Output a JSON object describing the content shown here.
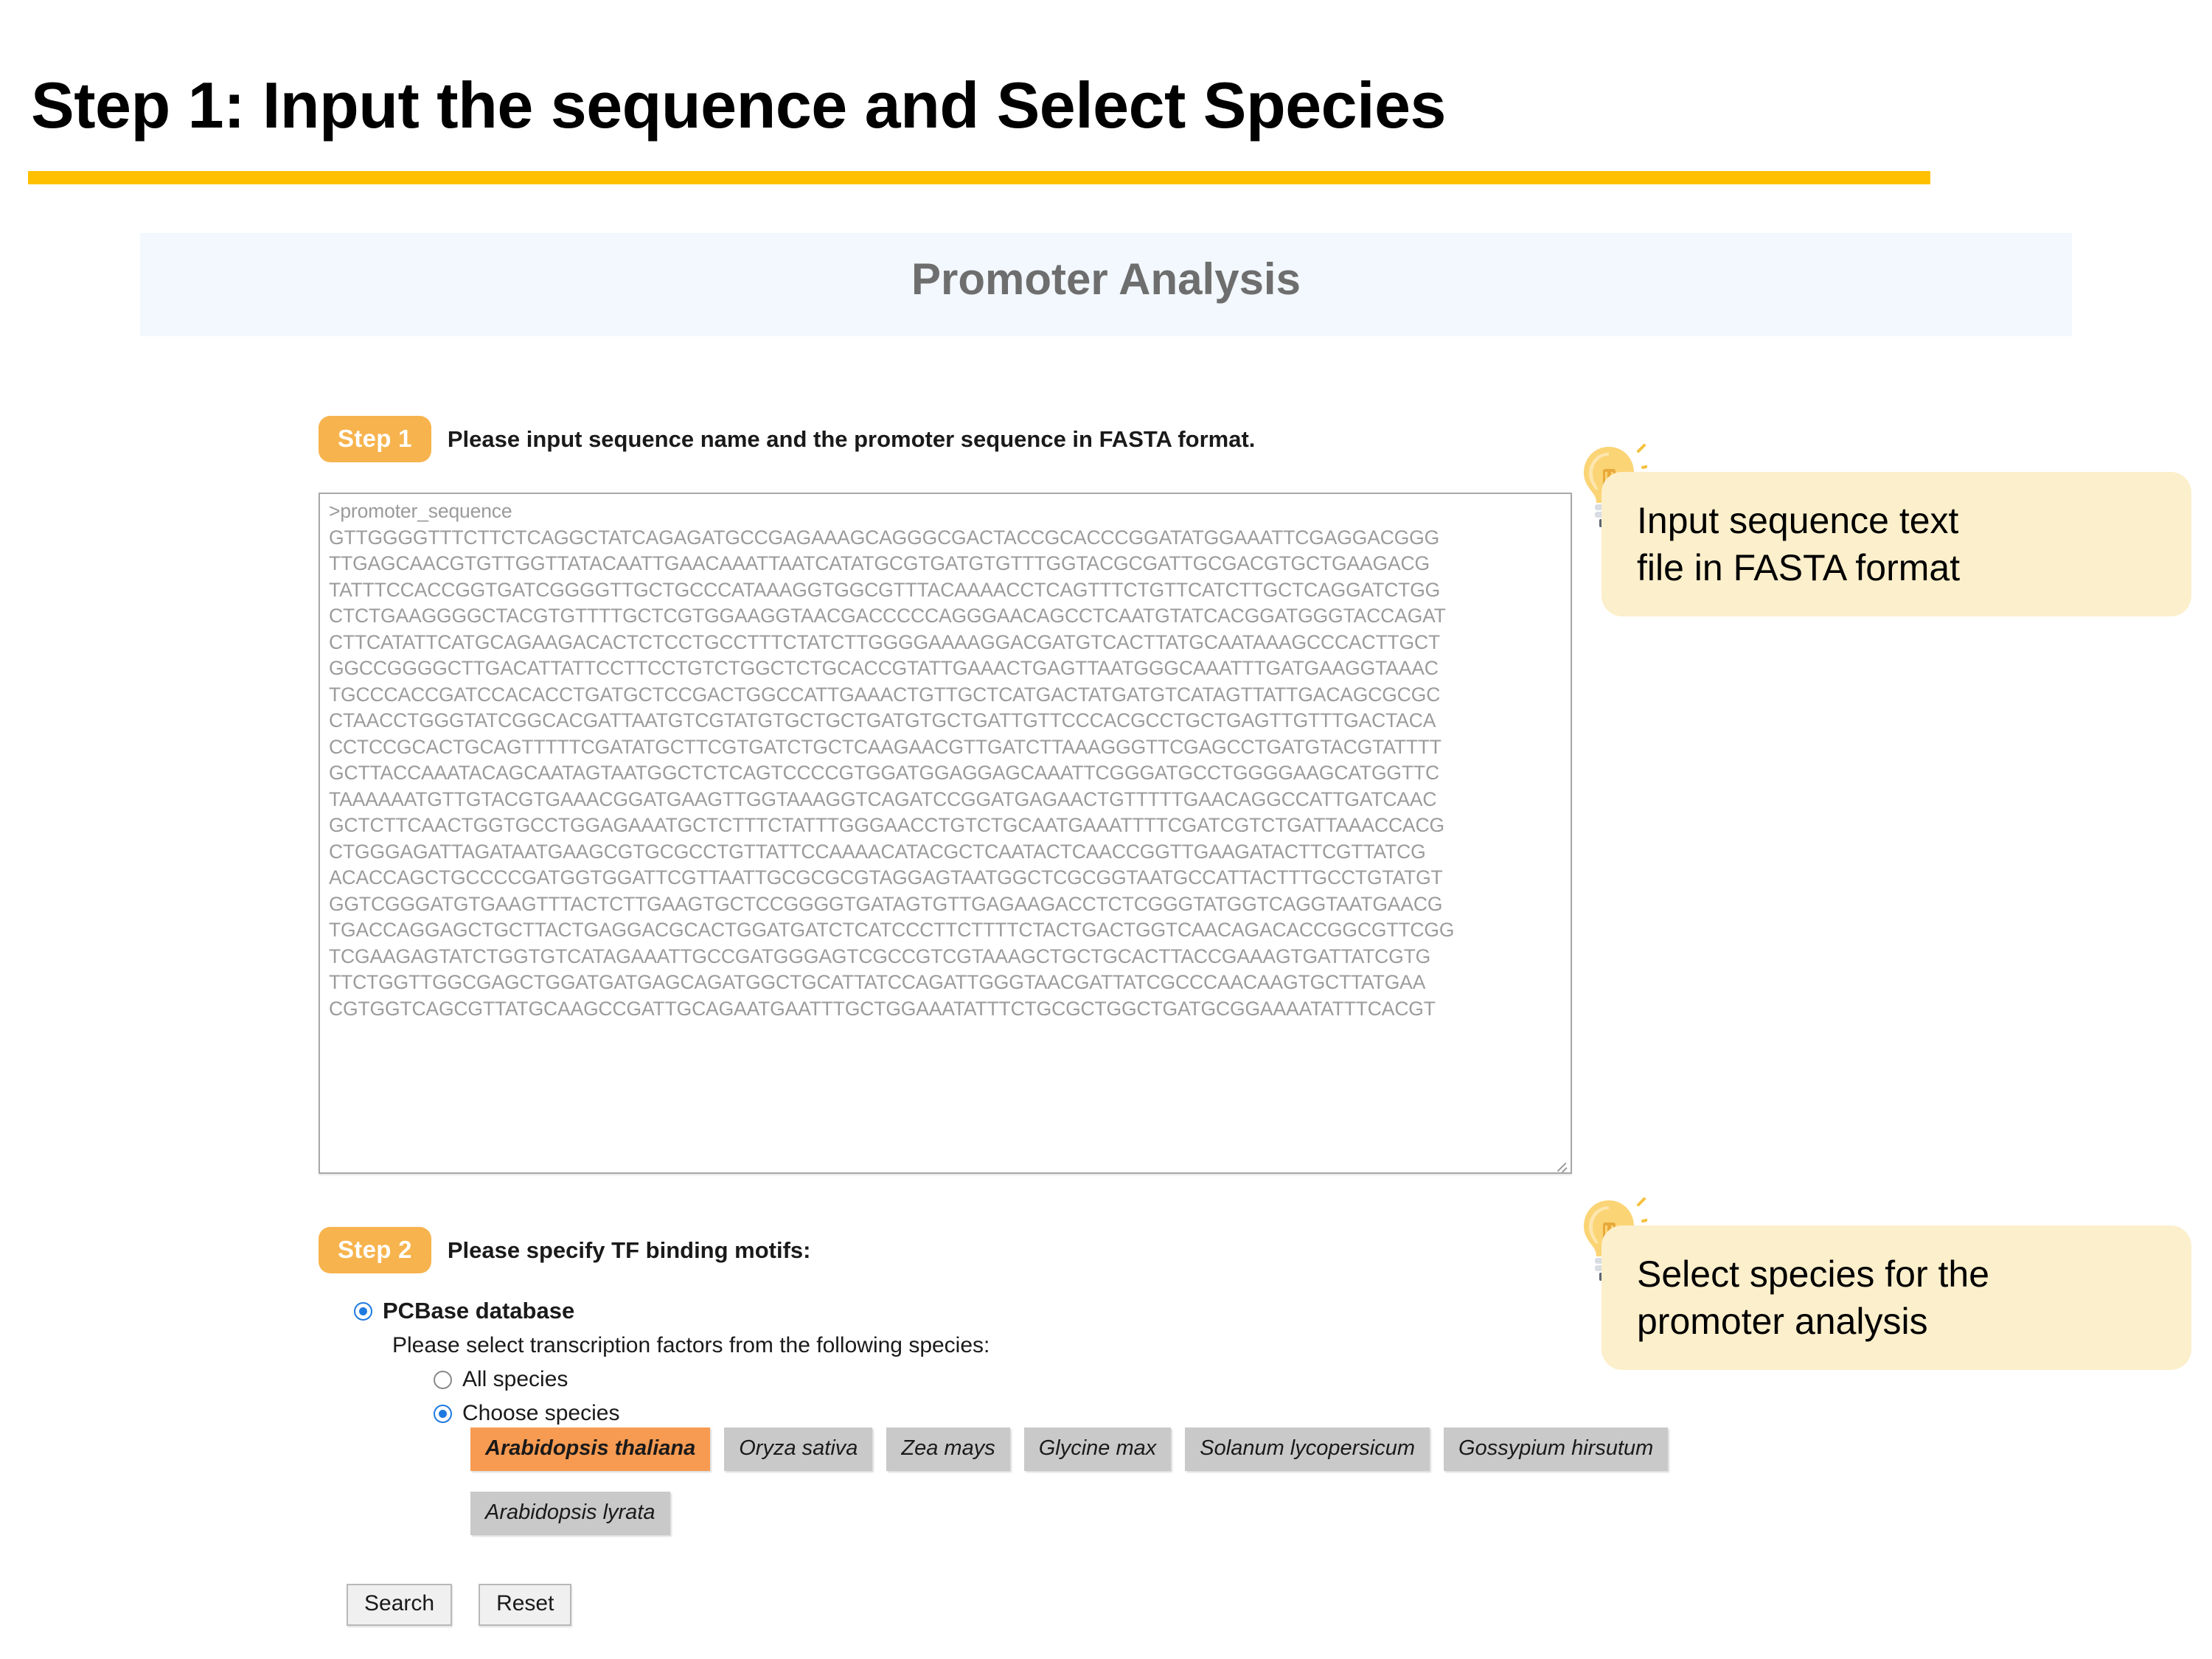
{
  "slide": {
    "title": "Step 1: Input the sequence and Select Species",
    "accent_color": "#FFC000"
  },
  "app": {
    "header_title": "Promoter Analysis",
    "header_bg": "#F2F8FD",
    "header_text_color": "#6E6E6E"
  },
  "step1": {
    "badge": "Step 1",
    "instruction": "Please input sequence name and the promoter sequence in FASTA format.",
    "badge_color": "#F7B34D",
    "sequence": ">promoter_sequence\nGTTGGGGTTTCTTCTCAGGCTATCAGAGATGCCGAGAAAGCAGGGCGACTACCGCACCCGGATATGGAAATTCGAGGACGGG\nTTGAGCAACGTGTTGGTTATACAATTGAACAAATTAATCATATGCGTGATGTGTTTGGTACGCGATTGCGACGTGCTGAAGACG\nTATTTCCACCGGTGATCGGGGTTGCTGCCCATAAAGGTGGCGTTTACAAAACCTCAGTTTCTGTTCATCTTGCTCAGGATCTGG\nCTCTGAAGGGGCTACGTGTTTTGCTCGTGGAAGGTAACGACCCCCAGGGAACAGCCTCAATGTATCACGGATGGGTACCAGAT\nCTTCATATTCATGCAGAAGACACTCTCCTGCCTTTCTATCTTGGGGAAAAGGACGATGTCACTTATGCAATAAAGCCCACTTGCT\nGGCCGGGGCTTGACATTATTCCTTCCTGTCTGGCTCTGCACCGTATTGAAACTGAGTTAATGGGCAAATTTGATGAAGGTAAAC\nTGCCCACCGATCCACACCTGATGCTCCGACTGGCCATTGAAACTGTTGCTCATGACTATGATGTCATAGTTATTGACAGCGCGC\nCTAACCTGGGTATCGGCACGATTAATGTCGTATGTGCTGCTGATGTGCTGATTGTTCCCACGCCTGCTGAGTTGTTTGACTACA\nCCTCCGCACTGCAGTTTTTCGATATGCTTCGTGATCTGCTCAAGAACGTTGATCTTAAAGGGTTCGAGCCTGATGTACGTATTTT\nGCTTACCAAATACAGCAATAGTAATGGCTCTCAGTCCCCGTGGATGGAGGAGCAAATTCGGGATGCCTGGGGAAGCATGGTTC\nTAAAAAATGTTGTACGTGAAACGGATGAAGTTGGTAAAGGTCAGATCCGGATGAGAACTGTTTTTGAACAGGCCATTGATCAAC\nGCTCTTCAACTGGTGCCTGGAGAAATGCTCTTTCTATTTGGGAACCTGTCTGCAATGAAATTTTCGATCGTCTGATTAAACCACG\nCTGGGAGATTAGATAATGAAGCGTGCGCCTGTTATTCCAAAACATACGCTCAATACTCAACCGGTTGAAGATACTTCGTTATCG\nACACCAGCTGCCCCGATGGTGGATTCGTTAATTGCGCGCGTAGGAGTAATGGCTCGCGGTAATGCCATTACTTTGCCTGTATGT\nGGTCGGGATGTGAAGTTTACTCTTGAAGTGCTCCGGGGTGATAGTGTTGAGAAGACCTCTCGGGTATGGTCAGGTAATGAACG\nTGACCAGGAGCTGCTTACTGAGGACGCACTGGATGATCTCATCCCTTCTTTTCTACTGACTGGTCAACAGACACCGGCGTTCGG\nTCGAAGAGTATCTGGTGTCATAGAAATTGCCGATGGGAGTCGCCGTCGTAAAGCTGCTGCACTTACCGAAAGTGATTATCGTG\nTTCTGGTTGGCGAGCTGGATGATGAGCAGATGGCTGCATTATCCAGATTGGGTAACGATTATCGCCCAACAAGTGCTTATGAA\nCGTGGTCAGCGTTATGCAAGCCGATTGCAGAATGAATTTGCTGGAAATATTTCTGCGCTGGCTGATGCGGAAAATATTTCACGT"
  },
  "step2": {
    "badge": "Step 2",
    "instruction": "Please specify TF binding motifs:",
    "database_option": {
      "label": "PCBase database",
      "checked": true
    },
    "species_instruction": "Please select transcription factors from the following species:",
    "scope_options": [
      {
        "label": "All species",
        "checked": false
      },
      {
        "label": "Choose species",
        "checked": true
      }
    ],
    "species": [
      {
        "name": "Arabidopsis thaliana",
        "selected": true
      },
      {
        "name": "Oryza sativa",
        "selected": false
      },
      {
        "name": "Zea mays",
        "selected": false
      },
      {
        "name": "Glycine max",
        "selected": false
      },
      {
        "name": "Solanum lycopersicum",
        "selected": false
      },
      {
        "name": "Gossypium hirsutum",
        "selected": false
      },
      {
        "name": "Arabidopsis lyrata",
        "selected": false
      }
    ],
    "selected_chip_color": "#F79B52",
    "chip_color": "#C9C9C9"
  },
  "actions": {
    "search_label": "Search",
    "reset_label": "Reset"
  },
  "callouts": [
    {
      "text": "Input sequence text\nfile in FASTA format",
      "bg": "#FCEFCB"
    },
    {
      "text": "Select species for  the\npromoter analysis",
      "bg": "#FCEFCB"
    }
  ]
}
